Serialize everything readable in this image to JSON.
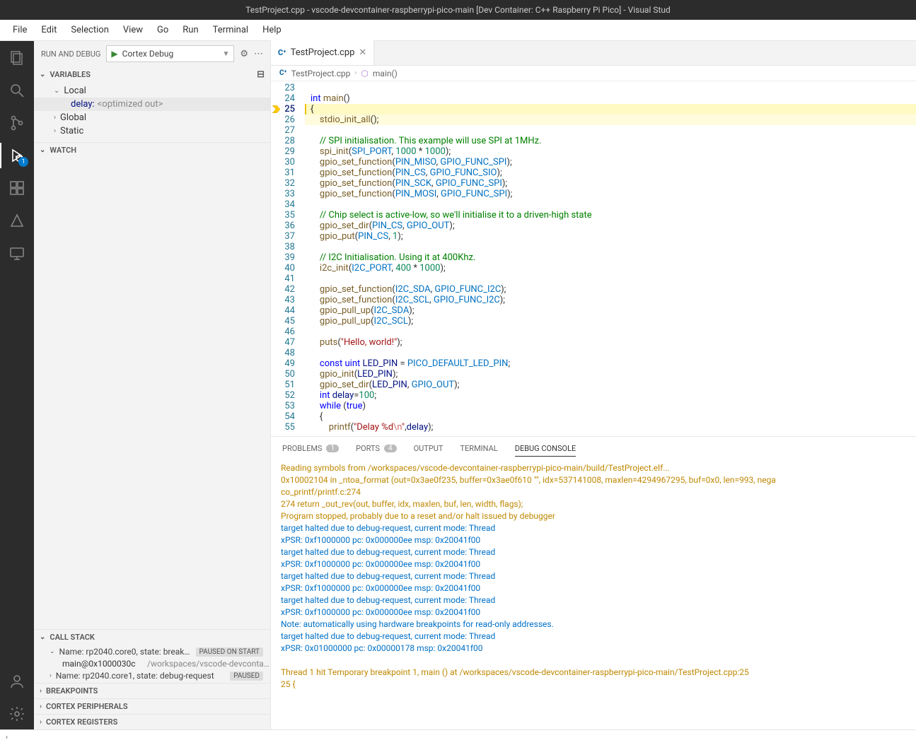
{
  "window": {
    "title": "TestProject.cpp - vscode-devcontainer-raspberrypi-pico-main [Dev Container: C++ Raspberry Pi Pico] - Visual Stud"
  },
  "menu": [
    "File",
    "Edit",
    "Selection",
    "View",
    "Go",
    "Run",
    "Terminal",
    "Help"
  ],
  "debug": {
    "title": "RUN AND DEBUG",
    "config": "Cortex Debug",
    "badge": "1"
  },
  "variables": {
    "header": "VARIABLES",
    "local": "Local",
    "localVar": {
      "key": "delay:",
      "val": "<optimized out>"
    },
    "global": "Global",
    "static": "Static"
  },
  "watch": {
    "header": "WATCH"
  },
  "callstack": {
    "header": "CALL STACK",
    "row0": {
      "text": "Name: rp2040.core0, state: breakp…",
      "badge": "PAUSED ON START"
    },
    "sub": {
      "fn": "main@0x1000030c",
      "path": "/workspaces/vscode-devcontai…"
    },
    "row1": {
      "text": "Name: rp2040.core1, state: debug-request",
      "badge": "PAUSED"
    }
  },
  "bpsection": {
    "header": "BREAKPOINTS"
  },
  "cortexPeriph": {
    "header": "CORTEX PERIPHERALS"
  },
  "cortexReg": {
    "header": "CORTEX REGISTERS"
  },
  "tab": {
    "name": "TestProject.cpp"
  },
  "breadcrumb": {
    "file": "TestProject.cpp",
    "fn": "main()"
  },
  "code": {
    "start": 23,
    "current": 25,
    "lines": [
      {
        "n": 23,
        "seg": []
      },
      {
        "n": 24,
        "seg": [
          {
            "c": "tk-kw",
            "t": "int"
          },
          {
            "t": " "
          },
          {
            "c": "tk-fn",
            "t": "main"
          },
          {
            "c": "tk-pun",
            "t": "()"
          }
        ]
      },
      {
        "n": 25,
        "hl": 2,
        "seg": [
          {
            "c": "tk-pun",
            "t": "{"
          }
        ]
      },
      {
        "n": 26,
        "hl": 1,
        "seg": [
          {
            "t": "    "
          },
          {
            "c": "tk-fn",
            "t": "stdio_init_all"
          },
          {
            "c": "tk-pun",
            "t": "();"
          }
        ]
      },
      {
        "n": 27,
        "seg": []
      },
      {
        "n": 28,
        "seg": [
          {
            "t": "    "
          },
          {
            "c": "tk-cm",
            "t": "// SPI initialisation. This example will use SPI at 1MHz."
          }
        ]
      },
      {
        "n": 29,
        "seg": [
          {
            "t": "    "
          },
          {
            "c": "tk-fn",
            "t": "spi_init"
          },
          {
            "c": "tk-pun",
            "t": "("
          },
          {
            "c": "tk-const",
            "t": "SPI_PORT"
          },
          {
            "c": "tk-pun",
            "t": ", "
          },
          {
            "c": "tk-num",
            "t": "1000"
          },
          {
            "c": "tk-op",
            "t": " * "
          },
          {
            "c": "tk-num",
            "t": "1000"
          },
          {
            "c": "tk-pun",
            "t": ");"
          }
        ]
      },
      {
        "n": 30,
        "seg": [
          {
            "t": "    "
          },
          {
            "c": "tk-fn",
            "t": "gpio_set_function"
          },
          {
            "c": "tk-pun",
            "t": "("
          },
          {
            "c": "tk-const",
            "t": "PIN_MISO"
          },
          {
            "c": "tk-pun",
            "t": ", "
          },
          {
            "c": "tk-const",
            "t": "GPIO_FUNC_SPI"
          },
          {
            "c": "tk-pun",
            "t": ");"
          }
        ]
      },
      {
        "n": 31,
        "seg": [
          {
            "t": "    "
          },
          {
            "c": "tk-fn",
            "t": "gpio_set_function"
          },
          {
            "c": "tk-pun",
            "t": "("
          },
          {
            "c": "tk-const",
            "t": "PIN_CS"
          },
          {
            "c": "tk-pun",
            "t": ", "
          },
          {
            "c": "tk-const",
            "t": "GPIO_FUNC_SIO"
          },
          {
            "c": "tk-pun",
            "t": ");"
          }
        ]
      },
      {
        "n": 32,
        "seg": [
          {
            "t": "    "
          },
          {
            "c": "tk-fn",
            "t": "gpio_set_function"
          },
          {
            "c": "tk-pun",
            "t": "("
          },
          {
            "c": "tk-const",
            "t": "PIN_SCK"
          },
          {
            "c": "tk-pun",
            "t": ", "
          },
          {
            "c": "tk-const",
            "t": "GPIO_FUNC_SPI"
          },
          {
            "c": "tk-pun",
            "t": ");"
          }
        ]
      },
      {
        "n": 33,
        "seg": [
          {
            "t": "    "
          },
          {
            "c": "tk-fn",
            "t": "gpio_set_function"
          },
          {
            "c": "tk-pun",
            "t": "("
          },
          {
            "c": "tk-const",
            "t": "PIN_MOSI"
          },
          {
            "c": "tk-pun",
            "t": ", "
          },
          {
            "c": "tk-const",
            "t": "GPIO_FUNC_SPI"
          },
          {
            "c": "tk-pun",
            "t": ");"
          }
        ]
      },
      {
        "n": 34,
        "seg": []
      },
      {
        "n": 35,
        "seg": [
          {
            "t": "    "
          },
          {
            "c": "tk-cm",
            "t": "// Chip select is active-low, so we'll initialise it to a driven-high state"
          }
        ]
      },
      {
        "n": 36,
        "seg": [
          {
            "t": "    "
          },
          {
            "c": "tk-fn",
            "t": "gpio_set_dir"
          },
          {
            "c": "tk-pun",
            "t": "("
          },
          {
            "c": "tk-const",
            "t": "PIN_CS"
          },
          {
            "c": "tk-pun",
            "t": ", "
          },
          {
            "c": "tk-const",
            "t": "GPIO_OUT"
          },
          {
            "c": "tk-pun",
            "t": ");"
          }
        ]
      },
      {
        "n": 37,
        "seg": [
          {
            "t": "    "
          },
          {
            "c": "tk-fn",
            "t": "gpio_put"
          },
          {
            "c": "tk-pun",
            "t": "("
          },
          {
            "c": "tk-const",
            "t": "PIN_CS"
          },
          {
            "c": "tk-pun",
            "t": ", "
          },
          {
            "c": "tk-num",
            "t": "1"
          },
          {
            "c": "tk-pun",
            "t": ");"
          }
        ]
      },
      {
        "n": 38,
        "seg": []
      },
      {
        "n": 39,
        "seg": [
          {
            "t": "    "
          },
          {
            "c": "tk-cm",
            "t": "// I2C Initialisation. Using it at 400Khz."
          }
        ]
      },
      {
        "n": 40,
        "seg": [
          {
            "t": "    "
          },
          {
            "c": "tk-fn",
            "t": "i2c_init"
          },
          {
            "c": "tk-pun",
            "t": "("
          },
          {
            "c": "tk-const",
            "t": "I2C_PORT"
          },
          {
            "c": "tk-pun",
            "t": ", "
          },
          {
            "c": "tk-num",
            "t": "400"
          },
          {
            "c": "tk-op",
            "t": " * "
          },
          {
            "c": "tk-num",
            "t": "1000"
          },
          {
            "c": "tk-pun",
            "t": ");"
          }
        ]
      },
      {
        "n": 41,
        "seg": []
      },
      {
        "n": 42,
        "seg": [
          {
            "t": "    "
          },
          {
            "c": "tk-fn",
            "t": "gpio_set_function"
          },
          {
            "c": "tk-pun",
            "t": "("
          },
          {
            "c": "tk-const",
            "t": "I2C_SDA"
          },
          {
            "c": "tk-pun",
            "t": ", "
          },
          {
            "c": "tk-const",
            "t": "GPIO_FUNC_I2C"
          },
          {
            "c": "tk-pun",
            "t": ");"
          }
        ]
      },
      {
        "n": 43,
        "seg": [
          {
            "t": "    "
          },
          {
            "c": "tk-fn",
            "t": "gpio_set_function"
          },
          {
            "c": "tk-pun",
            "t": "("
          },
          {
            "c": "tk-const",
            "t": "I2C_SCL"
          },
          {
            "c": "tk-pun",
            "t": ", "
          },
          {
            "c": "tk-const",
            "t": "GPIO_FUNC_I2C"
          },
          {
            "c": "tk-pun",
            "t": ");"
          }
        ]
      },
      {
        "n": 44,
        "seg": [
          {
            "t": "    "
          },
          {
            "c": "tk-fn",
            "t": "gpio_pull_up"
          },
          {
            "c": "tk-pun",
            "t": "("
          },
          {
            "c": "tk-const",
            "t": "I2C_SDA"
          },
          {
            "c": "tk-pun",
            "t": ");"
          }
        ]
      },
      {
        "n": 45,
        "seg": [
          {
            "t": "    "
          },
          {
            "c": "tk-fn",
            "t": "gpio_pull_up"
          },
          {
            "c": "tk-pun",
            "t": "("
          },
          {
            "c": "tk-const",
            "t": "I2C_SCL"
          },
          {
            "c": "tk-pun",
            "t": ");"
          }
        ]
      },
      {
        "n": 46,
        "seg": []
      },
      {
        "n": 47,
        "seg": [
          {
            "t": "    "
          },
          {
            "c": "tk-fn",
            "t": "puts"
          },
          {
            "c": "tk-pun",
            "t": "("
          },
          {
            "c": "tk-str",
            "t": "\"Hello, world!\""
          },
          {
            "c": "tk-pun",
            "t": ");"
          }
        ]
      },
      {
        "n": 48,
        "seg": []
      },
      {
        "n": 49,
        "seg": [
          {
            "t": "    "
          },
          {
            "c": "tk-kw",
            "t": "const"
          },
          {
            "t": " "
          },
          {
            "c": "tk-kw",
            "t": "uint"
          },
          {
            "t": " "
          },
          {
            "c": "tk-id",
            "t": "LED_PIN"
          },
          {
            "c": "tk-op",
            "t": " = "
          },
          {
            "c": "tk-const",
            "t": "PICO_DEFAULT_LED_PIN"
          },
          {
            "c": "tk-pun",
            "t": ";"
          }
        ]
      },
      {
        "n": 50,
        "seg": [
          {
            "t": "    "
          },
          {
            "c": "tk-fn",
            "t": "gpio_init"
          },
          {
            "c": "tk-pun",
            "t": "("
          },
          {
            "c": "tk-id",
            "t": "LED_PIN"
          },
          {
            "c": "tk-pun",
            "t": ");"
          }
        ]
      },
      {
        "n": 51,
        "seg": [
          {
            "t": "    "
          },
          {
            "c": "tk-fn",
            "t": "gpio_set_dir"
          },
          {
            "c": "tk-pun",
            "t": "("
          },
          {
            "c": "tk-id",
            "t": "LED_PIN"
          },
          {
            "c": "tk-pun",
            "t": ", "
          },
          {
            "c": "tk-const",
            "t": "GPIO_OUT"
          },
          {
            "c": "tk-pun",
            "t": ");"
          }
        ]
      },
      {
        "n": 52,
        "seg": [
          {
            "t": "    "
          },
          {
            "c": "tk-kw",
            "t": "int"
          },
          {
            "t": " "
          },
          {
            "c": "tk-id",
            "t": "delay"
          },
          {
            "c": "tk-op",
            "t": "="
          },
          {
            "c": "tk-num",
            "t": "100"
          },
          {
            "c": "tk-pun",
            "t": ";"
          }
        ]
      },
      {
        "n": 53,
        "seg": [
          {
            "t": "    "
          },
          {
            "c": "tk-kw",
            "t": "while"
          },
          {
            "t": " "
          },
          {
            "c": "tk-pun",
            "t": "("
          },
          {
            "c": "tk-kw",
            "t": "true"
          },
          {
            "c": "tk-pun",
            "t": ")"
          }
        ]
      },
      {
        "n": 54,
        "seg": [
          {
            "t": "    "
          },
          {
            "c": "tk-pun",
            "t": "{"
          }
        ]
      },
      {
        "n": 55,
        "seg": [
          {
            "t": "        "
          },
          {
            "c": "tk-fn",
            "t": "printf"
          },
          {
            "c": "tk-pun",
            "t": "("
          },
          {
            "c": "tk-str",
            "t": "\"Delay %d"
          },
          {
            "c": "tk-esc",
            "t": "\\n"
          },
          {
            "c": "tk-str",
            "t": "\""
          },
          {
            "c": "tk-pun",
            "t": ","
          },
          {
            "c": "tk-id",
            "t": "delay"
          },
          {
            "c": "tk-pun",
            "t": ");"
          }
        ]
      }
    ]
  },
  "panelTabs": {
    "problems": "PROBLEMS",
    "problemsCount": "1",
    "ports": "PORTS",
    "portsCount": "4",
    "output": "OUTPUT",
    "terminal": "TERMINAL",
    "debugConsole": "DEBUG CONSOLE"
  },
  "console": [
    {
      "c": "warn",
      "t": "Reading symbols from /workspaces/vscode-devcontainer-raspberrypi-pico-main/build/TestProject.elf..."
    },
    {
      "c": "warn",
      "t": "0x10002104 in _ntoa_format (out=0x3ae0f235, buffer=0x3ae0f610 \"\", idx=537141008, maxlen=4294967295, buf=0x0, len=993, nega"
    },
    {
      "c": "warn",
      "t": "co_printf/printf.c:274"
    },
    {
      "c": "warn",
      "t": "274         return _out_rev(out, buffer, idx, maxlen, buf, len, width, flags);"
    },
    {
      "c": "warn",
      "t": "Program stopped, probably due to a reset and/or halt issued by debugger"
    },
    {
      "c": "info",
      "t": "target halted due to debug-request, current mode: Thread"
    },
    {
      "c": "info",
      "t": "xPSR: 0xf1000000 pc: 0x000000ee msp: 0x20041f00"
    },
    {
      "c": "info",
      "t": "target halted due to debug-request, current mode: Thread"
    },
    {
      "c": "info",
      "t": "xPSR: 0xf1000000 pc: 0x000000ee msp: 0x20041f00"
    },
    {
      "c": "info",
      "t": "target halted due to debug-request, current mode: Thread"
    },
    {
      "c": "info",
      "t": "xPSR: 0xf1000000 pc: 0x000000ee msp: 0x20041f00"
    },
    {
      "c": "info",
      "t": "target halted due to debug-request, current mode: Thread"
    },
    {
      "c": "info",
      "t": "xPSR: 0xf1000000 pc: 0x000000ee msp: 0x20041f00"
    },
    {
      "c": "info",
      "t": "Note: automatically using hardware breakpoints for read-only addresses."
    },
    {
      "c": "info",
      "t": "target halted due to debug-request, current mode: Thread"
    },
    {
      "c": "info",
      "t": "xPSR: 0x01000000 pc: 0x00000178 msp: 0x20041f00"
    },
    {
      "c": "",
      "t": ""
    },
    {
      "c": "warn",
      "t": "Thread 1 hit Temporary breakpoint 1, main () at /workspaces/vscode-devcontainer-raspberrypi-pico-main/TestProject.cpp:25"
    },
    {
      "c": "warn",
      "t": "25      {"
    }
  ]
}
